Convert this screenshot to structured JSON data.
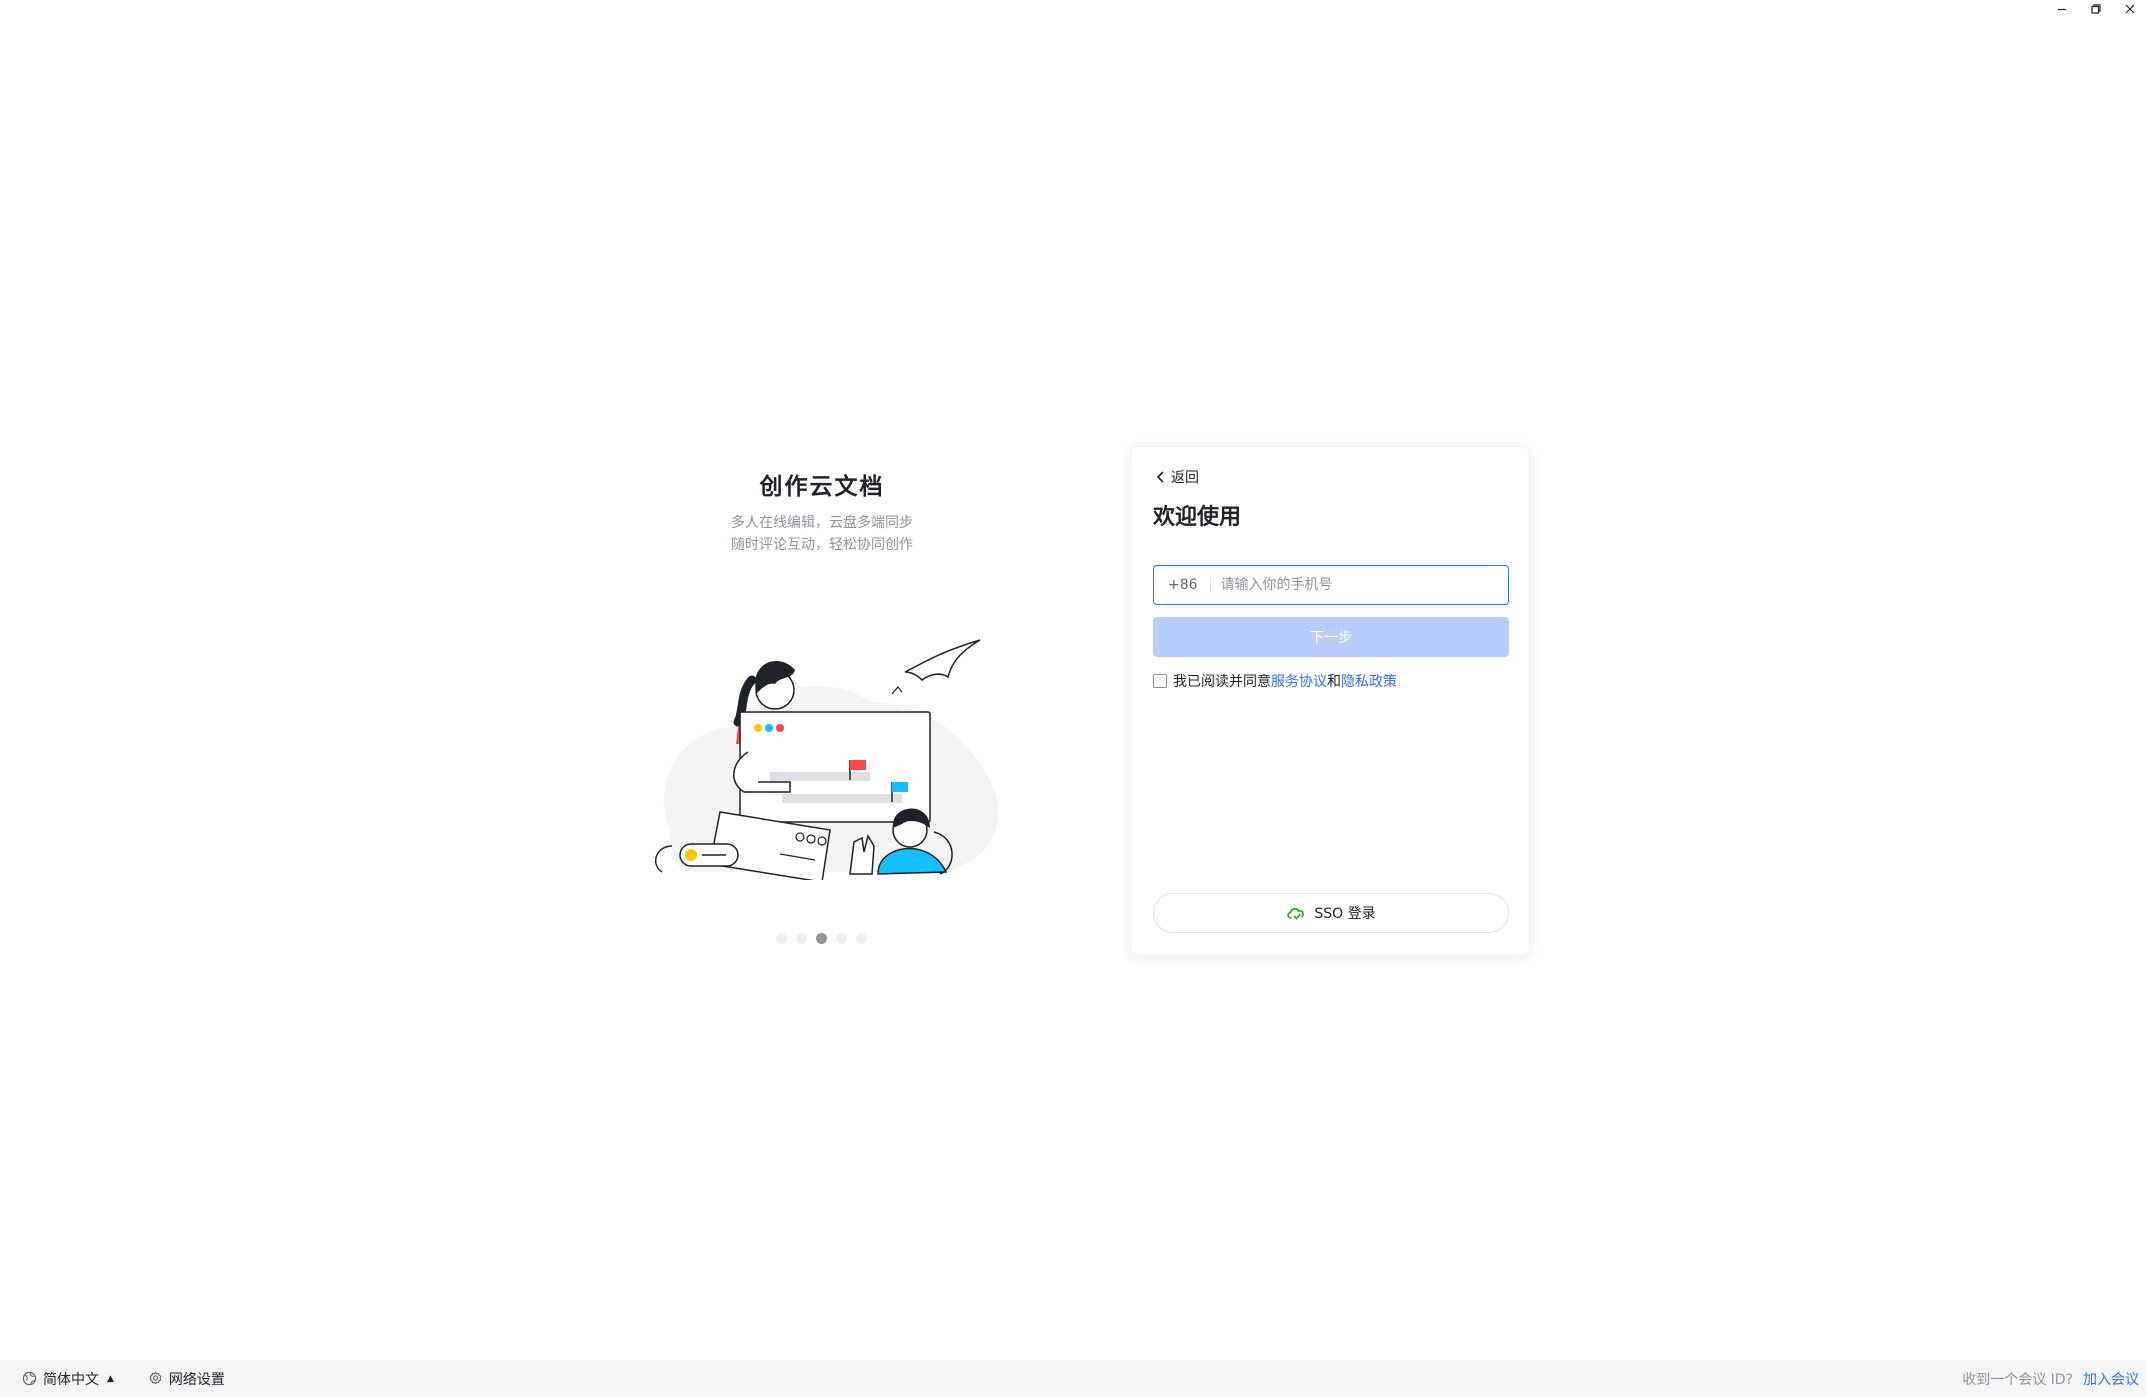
{
  "window": {
    "minimize_icon": "minimize-icon",
    "restore_icon": "restore-icon",
    "close_icon": "close-icon"
  },
  "promo": {
    "title": "创作云文档",
    "line1": "多人在线编辑，云盘多端同步",
    "line2": "随时评论互动，轻松协同创作",
    "slide_count": 5,
    "active_slide": 3
  },
  "login": {
    "back_label": "返回",
    "title": "欢迎使用",
    "country_code": "+86",
    "phone_value": "",
    "phone_placeholder": "请输入你的手机号",
    "next_label": "下一步",
    "agree_prefix": "我已阅读并同意",
    "terms_label": "服务协议",
    "and_label": "和",
    "privacy_label": "隐私政策",
    "sso_label": "SSO 登录"
  },
  "footer": {
    "language_label": "简体中文",
    "network_label": "网络设置",
    "meeting_hint": "收到一个会议 ID?",
    "join_meeting_label": "加入会议"
  },
  "colors": {
    "accent": "#3370ff",
    "button_disabled": "#bacefd",
    "footer_bg": "#f5f6f7"
  }
}
